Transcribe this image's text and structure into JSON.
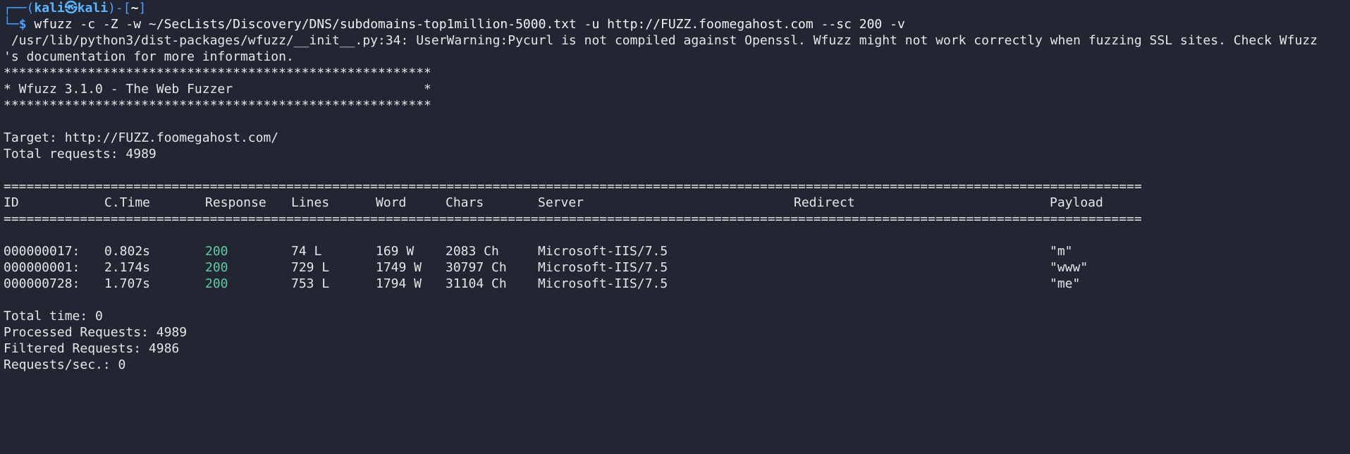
{
  "prompt": {
    "corner_top": "┌──(",
    "user": "kali",
    "at": "㉿",
    "host": "kali",
    "mid": ")-[",
    "dir": "~",
    "end": "]",
    "corner_bottom": "└─",
    "dollar": "$",
    "command": " wfuzz -c -Z -w ~/SecLists/Discovery/DNS/subdomains-top1million-5000.txt -u http://FUZZ.foomegahost.com --sc 200 -v"
  },
  "warning": {
    "line1": " /usr/lib/python3/dist-packages/wfuzz/__init__.py:34: UserWarning:Pycurl is not compiled against Openssl. Wfuzz might not work correctly when fuzzing SSL sites. Check Wfuzz",
    "line2": "'s documentation for more information."
  },
  "banner": {
    "stars": "********************************************************",
    "title": "* Wfuzz 3.1.0 - The Web Fuzzer                         *"
  },
  "target": "Target: http://FUZZ.foomegahost.com/",
  "total_requests": "Total requests: 4989",
  "separator": "=====================================================================================================================================================",
  "headers": {
    "id": "ID",
    "ctime": "C.Time",
    "response": "Response",
    "lines": "Lines",
    "word": "Word",
    "chars": "Chars",
    "server": "Server",
    "redirect": "Redirect",
    "payload": "Payload"
  },
  "rows": [
    {
      "id": "000000017:",
      "ctime": "0.802s",
      "response": "200",
      "lines": "74 L",
      "word": "169 W",
      "chars": "2083 Ch",
      "server": "Microsoft-IIS/7.5",
      "redirect": "",
      "payload": "\"m\""
    },
    {
      "id": "000000001:",
      "ctime": "2.174s",
      "response": "200",
      "lines": "729 L",
      "word": "1749 W",
      "chars": "30797 Ch",
      "server": "Microsoft-IIS/7.5",
      "redirect": "",
      "payload": "\"www\""
    },
    {
      "id": "000000728:",
      "ctime": "1.707s",
      "response": "200",
      "lines": "753 L",
      "word": "1794 W",
      "chars": "31104 Ch",
      "server": "Microsoft-IIS/7.5",
      "redirect": "",
      "payload": "\"me\""
    }
  ],
  "summary": {
    "total_time": "Total time: 0",
    "processed": "Processed Requests: 4989",
    "filtered": "Filtered Requests: 4986",
    "rate": "Requests/sec.: 0"
  },
  "colors": {
    "background": "#222633",
    "prompt_blue": "#4a9fff",
    "status_green": "#5fc9a3",
    "text": "#e6e6e6"
  }
}
